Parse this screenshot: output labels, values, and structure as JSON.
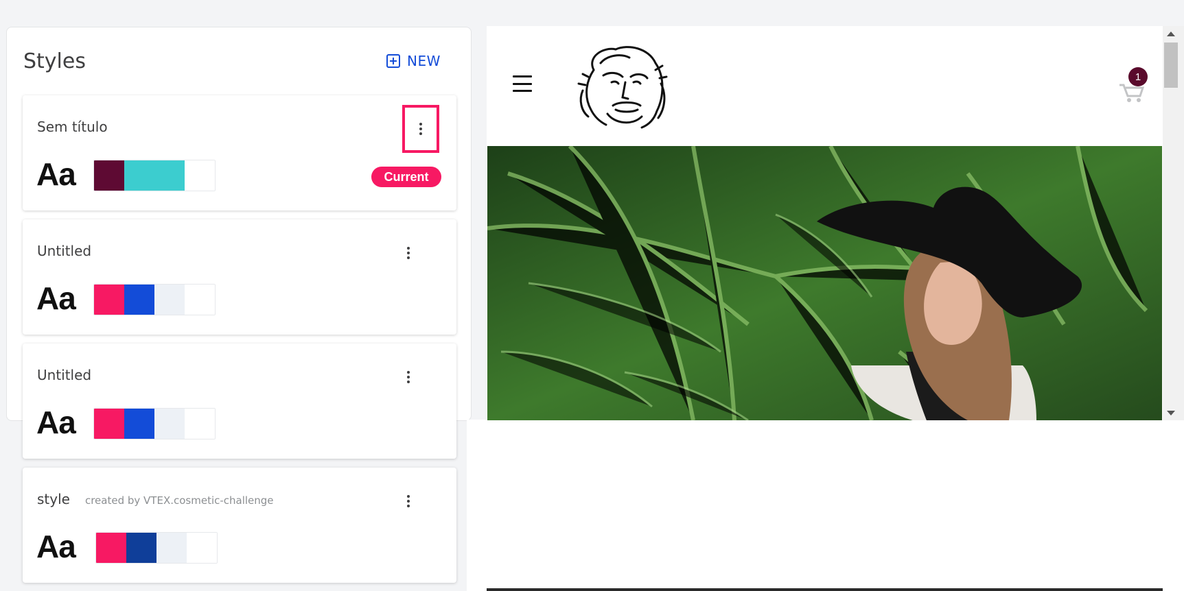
{
  "panel": {
    "title": "Styles",
    "new_label": "NEW"
  },
  "styles": [
    {
      "name": "Sem título",
      "subtitle": "",
      "aa": "Aa",
      "badge": "Current",
      "colors": [
        "#5e0a33",
        "#3ccdcf",
        "#ffffff"
      ]
    },
    {
      "name": "Untitled",
      "subtitle": "",
      "aa": "Aa",
      "colors": [
        "#f71963",
        "#134cd8",
        "#edf1f6",
        "#ffffff"
      ]
    },
    {
      "name": "Untitled",
      "subtitle": "",
      "aa": "Aa",
      "colors": [
        "#f71963",
        "#134cd8",
        "#edf1f6",
        "#ffffff"
      ]
    },
    {
      "name": "style",
      "subtitle": "created by VTEX.cosmetic-challenge",
      "aa": "Aa",
      "colors": [
        "#f71963",
        "#0f3e99",
        "#edf1f6",
        "#ffffff"
      ]
    }
  ],
  "preview": {
    "cart_count": "1",
    "cart_badge_color": "#5a0a2c",
    "menu_icon": "hamburger-icon",
    "cart_icon": "cart-icon",
    "logo_icon": "face-logo-icon"
  }
}
